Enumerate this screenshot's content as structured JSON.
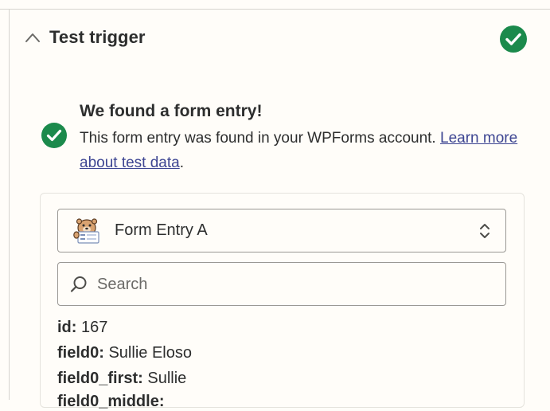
{
  "section": {
    "title": "Test trigger"
  },
  "result": {
    "title": "We found a form entry!",
    "description": "This form entry was found in your WPForms account. ",
    "link_text": "Learn more about test data",
    "link_suffix": "."
  },
  "selector": {
    "value": "Form Entry A"
  },
  "search": {
    "placeholder": "Search",
    "value": ""
  },
  "fields": [
    {
      "key": "id:",
      "value": "167"
    },
    {
      "key": "field0:",
      "value": "Sullie Eloso"
    },
    {
      "key": "field0_first:",
      "value": "Sullie"
    },
    {
      "key": "field0_middle:",
      "value": ""
    }
  ],
  "colors": {
    "success_green": "#1b8a4c",
    "link_blue": "#3d4592"
  },
  "icons": [
    "chevron-up-icon",
    "check-circle-icon",
    "wpforms-logo-icon",
    "chevron-up-down-icon",
    "search-icon"
  ]
}
